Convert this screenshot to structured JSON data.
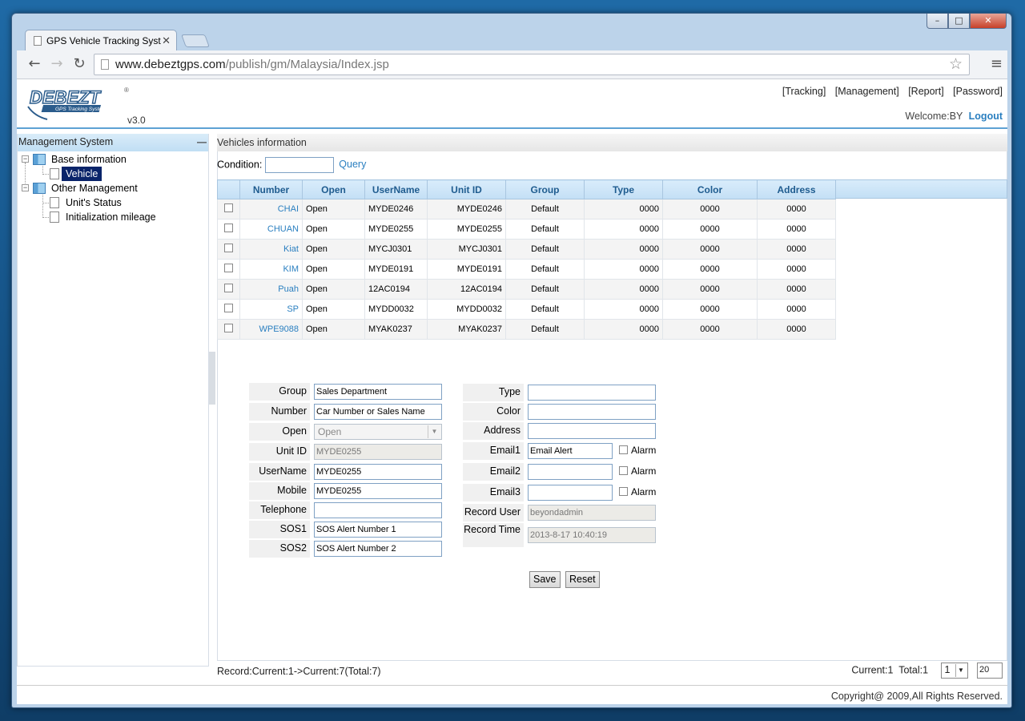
{
  "browser": {
    "tab_title": "GPS Vehicle Tracking Syst",
    "url_host": "www.debeztgps.com",
    "url_path": "/publish/gm/Malaysia/Index.jsp"
  },
  "header": {
    "logo_text": "DEBEZT",
    "logo_sub": "GPS Tracking System",
    "version": "v3.0",
    "nav": [
      "[Tracking]",
      "[Management]",
      "[Report]",
      "[Password]"
    ],
    "welcome": "Welcome:BY",
    "logout": "Logout"
  },
  "sidebar": {
    "title": "Management System",
    "collapse": "—",
    "groups": [
      {
        "label": "Base information",
        "items": [
          "Vehicle"
        ]
      },
      {
        "label": "Other Management",
        "items": [
          "Unit's Status",
          "Initialization mileage"
        ]
      }
    ]
  },
  "main": {
    "title": "Vehicles information",
    "condition_label": "Condition:",
    "query_label": "Query",
    "columns": [
      "Number",
      "Open",
      "UserName",
      "Unit ID",
      "Group",
      "Type",
      "Color",
      "Address"
    ],
    "rows": [
      [
        "CHAI",
        "Open",
        "MYDE0246",
        "MYDE0246",
        "Default",
        "0000",
        "0000",
        "0000"
      ],
      [
        "CHUAN",
        "Open",
        "MYDE0255",
        "MYDE0255",
        "Default",
        "0000",
        "0000",
        "0000"
      ],
      [
        "Kiat",
        "Open",
        "MYCJ0301",
        "MYCJ0301",
        "Default",
        "0000",
        "0000",
        "0000"
      ],
      [
        "KIM",
        "Open",
        "MYDE0191",
        "MYDE0191",
        "Default",
        "0000",
        "0000",
        "0000"
      ],
      [
        "Puah",
        "Open",
        "12AC0194",
        "12AC0194",
        "Default",
        "0000",
        "0000",
        "0000"
      ],
      [
        "SP",
        "Open",
        "MYDD0032",
        "MYDD0032",
        "Default",
        "0000",
        "0000",
        "0000"
      ],
      [
        "WPE9088",
        "Open",
        "MYAK0237",
        "MYAK0237",
        "Default",
        "0000",
        "0000",
        "0000"
      ]
    ]
  },
  "form": {
    "left": [
      {
        "label": "Group",
        "value": "Sales Department"
      },
      {
        "label": "Number",
        "value": "Car Number or Sales Name"
      },
      {
        "label": "Open",
        "value": "Open"
      },
      {
        "label": "Unit ID",
        "value": "MYDE0255"
      },
      {
        "label": "UserName",
        "value": "MYDE0255"
      },
      {
        "label": "Mobile",
        "value": "MYDE0255"
      },
      {
        "label": "Telephone",
        "value": ""
      },
      {
        "label": "SOS1",
        "value": "SOS Alert Number 1"
      },
      {
        "label": "SOS2",
        "value": "SOS Alert Number 2"
      }
    ],
    "right": [
      {
        "label": "Type",
        "value": ""
      },
      {
        "label": "Color",
        "value": ""
      },
      {
        "label": "Address",
        "value": ""
      },
      {
        "label": "Email1",
        "value": "Email Alert"
      },
      {
        "label": "Email2",
        "value": ""
      },
      {
        "label": "Email3",
        "value": ""
      },
      {
        "label": "Record User",
        "value": "beyondadmin"
      },
      {
        "label": "Record Time",
        "value": "2013-8-17 10:40:19"
      }
    ],
    "alarm_label": "Alarm",
    "save_label": "Save",
    "reset_label": "Reset"
  },
  "footer": {
    "record_text": "Record:Current:1->Current:7(Total:7)",
    "pager_current": "Current:1",
    "pager_total": "Total:1",
    "page_select": "1",
    "page_size": "20",
    "copyright": "Copyright@ 2009,All Rights Reserved."
  },
  "colors": {
    "accent": "#2a7fc0",
    "header_bar": "#5ea2d4",
    "selection": "#0a246a"
  }
}
